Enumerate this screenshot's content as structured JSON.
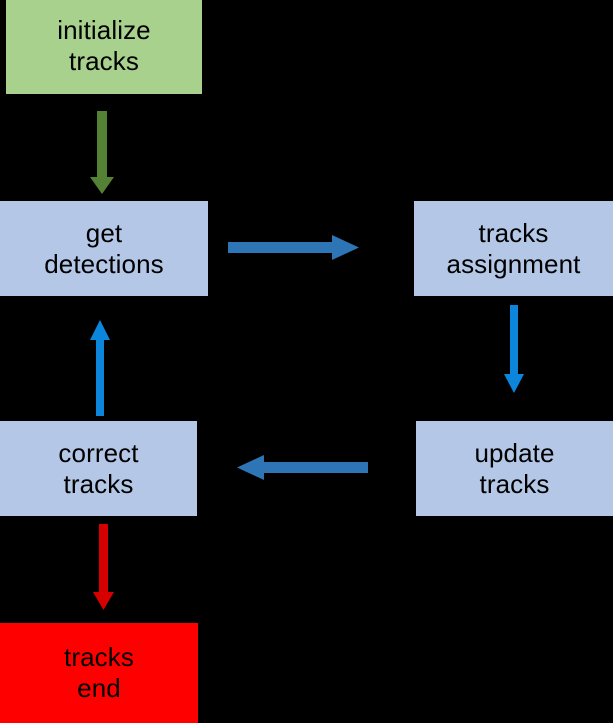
{
  "diagram": {
    "title": "multi-object tracking pipeline flowchart",
    "background_color": "#000000",
    "text_color": "#000000",
    "nodes": [
      {
        "id": "initialize-tracks",
        "line1": "initialize",
        "line2": "tracks",
        "fill": "#a9d18e",
        "role": "start"
      },
      {
        "id": "get-detections",
        "line1": "get",
        "line2": "detections",
        "fill": "#b4c7e7",
        "role": "process"
      },
      {
        "id": "tracks-assignment",
        "line1": "tracks",
        "line2": "assignment",
        "fill": "#b4c7e7",
        "role": "process"
      },
      {
        "id": "correct-tracks",
        "line1": "correct",
        "line2": "tracks",
        "fill": "#b4c7e7",
        "role": "process"
      },
      {
        "id": "update-tracks",
        "line1": "update",
        "line2": "tracks",
        "fill": "#b4c7e7",
        "role": "process"
      },
      {
        "id": "tracks-end",
        "line1": "tracks",
        "line2": "end",
        "fill": "#ff0000",
        "role": "end"
      }
    ],
    "edges": [
      {
        "id": "init-to-detections",
        "from": "initialize-tracks",
        "to": "get-detections",
        "direction": "down",
        "color": "#548235",
        "label": ""
      },
      {
        "id": "detections-to-assignment",
        "from": "get-detections",
        "to": "tracks-assignment",
        "direction": "right",
        "color": "#2e75b6",
        "label": ""
      },
      {
        "id": "assignment-to-update",
        "from": "tracks-assignment",
        "to": "update-tracks",
        "direction": "down",
        "color": "#0c86dd",
        "label": ""
      },
      {
        "id": "update-to-correct",
        "from": "update-tracks",
        "to": "correct-tracks",
        "direction": "left",
        "color": "#2e75b6",
        "label": ""
      },
      {
        "id": "correct-to-detections",
        "from": "correct-tracks",
        "to": "get-detections",
        "direction": "up",
        "color": "#0c86dd",
        "label": ""
      },
      {
        "id": "correct-to-end",
        "from": "correct-tracks",
        "to": "tracks-end",
        "direction": "down",
        "color": "#d60000",
        "label": ""
      }
    ]
  }
}
